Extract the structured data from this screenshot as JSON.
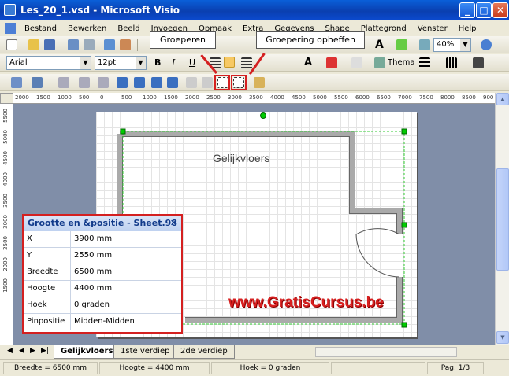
{
  "window": {
    "title": "Les_20_1.vsd - Microsoft Visio"
  },
  "menu": [
    "Bestand",
    "Bewerken",
    "Beeld",
    "Invoegen",
    "Opmaak",
    "Extra",
    "Gegevens",
    "Shape",
    "Plattegrond",
    "Venster",
    "Help"
  ],
  "format_toolbar": {
    "font": "Arial",
    "size": "12pt",
    "theme_label": "Thema"
  },
  "standard_toolbar": {
    "zoom": "40%"
  },
  "callouts": {
    "group": "Groeperen",
    "ungroup": "Groepering opheffen"
  },
  "ruler": {
    "h_ticks": [
      "2000",
      "1500",
      "1000",
      "500",
      "0",
      "500",
      "1000",
      "1500",
      "2000",
      "2500",
      "3000",
      "3500",
      "4000",
      "4500",
      "5000",
      "5500",
      "6000",
      "6500",
      "7000",
      "7500",
      "8000",
      "8500",
      "900"
    ],
    "v_ticks": [
      "5500",
      "5000",
      "4500",
      "4000",
      "3500",
      "3000",
      "2500",
      "2000",
      "1500"
    ]
  },
  "drawing": {
    "room_label": "Gelijkvloers",
    "watermark": "www.GratisCursus.be"
  },
  "size_panel": {
    "title": "Grootte en &positie - Sheet.98",
    "close": "✕",
    "rows": [
      {
        "key": "X",
        "value": "3900 mm"
      },
      {
        "key": "Y",
        "value": "2550 mm"
      },
      {
        "key": "Breedte",
        "value": "6500 mm"
      },
      {
        "key": "Hoogte",
        "value": "4400 mm"
      },
      {
        "key": "Hoek",
        "value": "0 graden"
      },
      {
        "key": "Pinpositie",
        "value": "Midden-Midden"
      }
    ]
  },
  "tabs": [
    "Gelijkvloers",
    "1ste verdiep",
    "2de verdiep"
  ],
  "status": {
    "width": "Breedte = 6500 mm",
    "height": "Hoogte = 4400 mm",
    "angle": "Hoek = 0 graden",
    "page": "Pag. 1/3"
  }
}
